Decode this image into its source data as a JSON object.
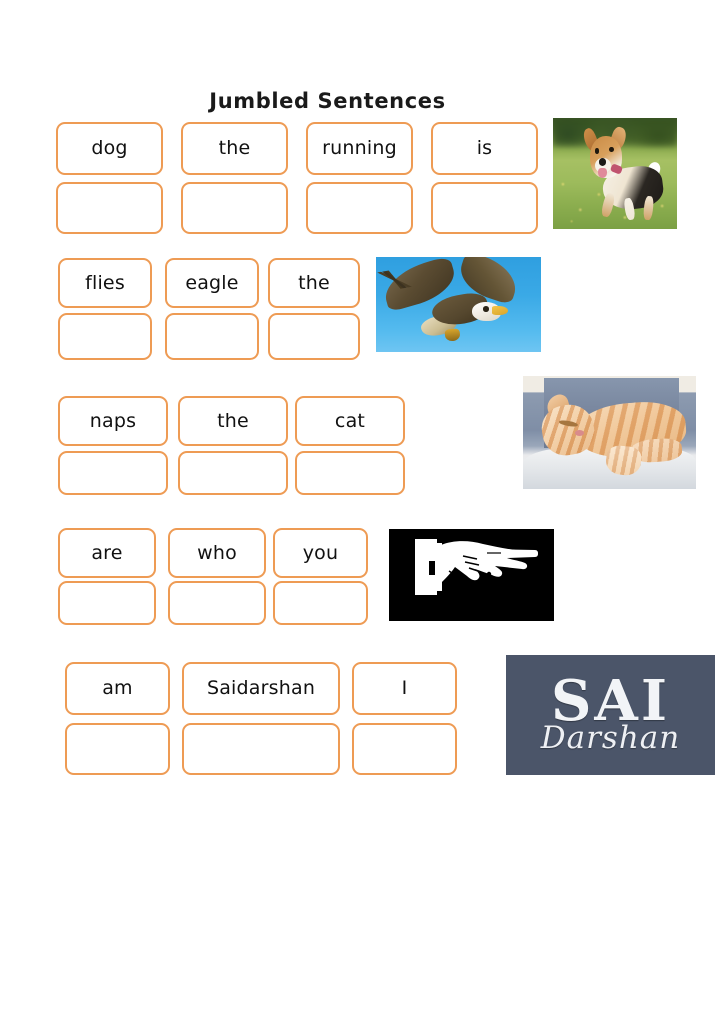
{
  "page": {
    "title": "Jumbled Sentences",
    "background_color": "#ffffff",
    "box_border_color": "#ee9b54",
    "text_color": "#111111"
  },
  "rows": [
    {
      "id": "row-1",
      "words": [
        "dog",
        "the",
        "running",
        "is"
      ],
      "answer_boxes": 4,
      "picture": {
        "name": "dog-photo",
        "alt": "A beagle puppy running across green grass"
      }
    },
    {
      "id": "row-2",
      "words": [
        "flies",
        "eagle",
        "the"
      ],
      "answer_boxes": 3,
      "picture": {
        "name": "eagle-photo",
        "alt": "A bald eagle flying in a blue sky"
      }
    },
    {
      "id": "row-3",
      "words": [
        "naps",
        "the",
        "cat"
      ],
      "answer_boxes": 3,
      "picture": {
        "name": "cat-photo",
        "alt": "An orange tabby cat sleeping on a couch"
      }
    },
    {
      "id": "row-4",
      "words": [
        "are",
        "who",
        "you"
      ],
      "answer_boxes": 3,
      "picture": {
        "name": "pointing-hand-image",
        "alt": "White pointing hand on black background"
      }
    },
    {
      "id": "row-5",
      "words": [
        "am",
        "Saidarshan",
        "I"
      ],
      "answer_boxes": 3,
      "picture": {
        "name": "sai-darshan-logo",
        "alt": "SAI Darshan logo",
        "logo_top_text": "SAI",
        "logo_bottom_text": "Darshan",
        "logo_background_color": "#4b5569",
        "logo_text_color": "#f2f4f7"
      }
    }
  ]
}
